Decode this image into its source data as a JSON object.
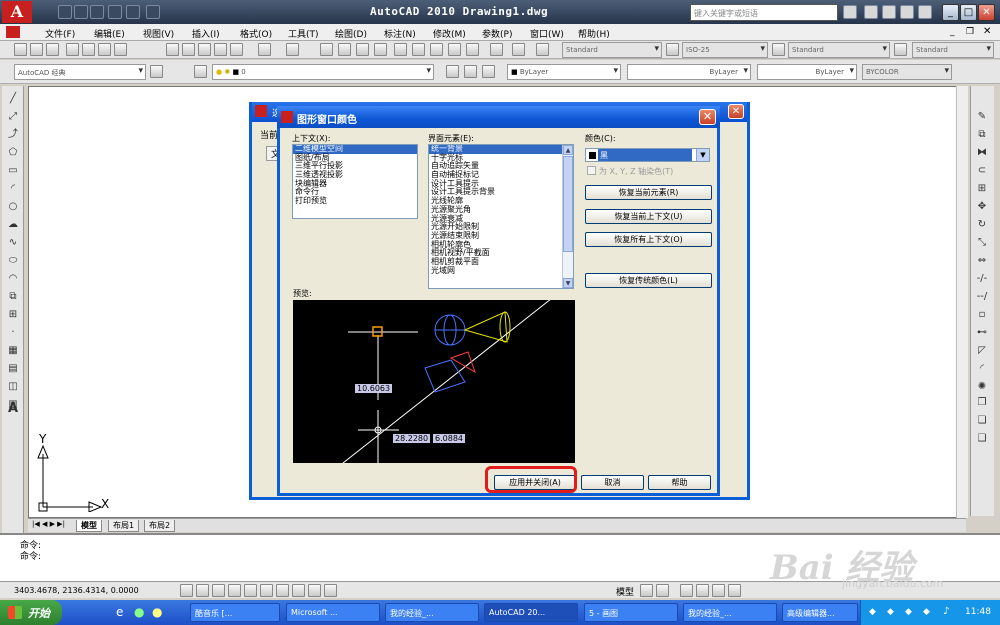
{
  "app": {
    "title": "AutoCAD 2010   Drawing1.dwg",
    "search_placeholder": "键入关键字或短语",
    "menu": [
      "文件(F)",
      "编辑(E)",
      "视图(V)",
      "插入(I)",
      "格式(O)",
      "工具(T)",
      "绘图(D)",
      "标注(N)",
      "修改(M)",
      "参数(P)",
      "窗口(W)",
      "帮助(H)"
    ],
    "toolbar": {
      "text_style": "Standard",
      "dim_style": "ISO-25",
      "table_style": "Standard",
      "mleader_style": "Standard",
      "workspace": "AutoCAD 经典",
      "layer": "0",
      "color": "ByLayer",
      "linetype": "ByLayer",
      "lineweight": "ByLayer",
      "plotstyle": "BYCOLOR"
    }
  },
  "layout_tabs": [
    "模型",
    "布局1",
    "布局2"
  ],
  "command": {
    "line1": "命令:",
    "line2": "命令:"
  },
  "status": {
    "coords": "3403.4678, 2136.4314, 0.0000",
    "model": "模型"
  },
  "ucs": {
    "x": "X",
    "y": "Y"
  },
  "back_dialog": {
    "title": "选",
    "current_label": "当前",
    "tab": "文"
  },
  "dialog": {
    "title": "图形窗口颜色",
    "context_label": "上下文(X):",
    "contexts": [
      "二维模型空间",
      "图纸/布局",
      "三维平行投影",
      "三维透视投影",
      "块编辑器",
      "命令行",
      "打印预览"
    ],
    "element_label": "界面元素(E):",
    "elements": [
      "统一背景",
      "十字光标",
      "自动追踪矢量",
      "自动捕捉标记",
      "设计工具提示",
      "设计工具提示背景",
      "光线轮廓",
      "光源聚光角",
      "光源衰减",
      "光源开始限制",
      "光源结束限制",
      "相机轮廓色",
      "相机视野/平截面",
      "相机剪裁平面",
      "光域网"
    ],
    "color_label": "颜色(C):",
    "color_value": "黑",
    "tint_label": "为 X, Y, Z 轴染色(T)",
    "btn_restore_element": "恢复当前元素(R)",
    "btn_restore_context": "恢复当前上下文(U)",
    "btn_restore_all": "恢复所有上下文(O)",
    "btn_restore_classic": "恢复传统颜色(L)",
    "preview_label": "预览:",
    "preview_dims": [
      "10.6063",
      "28.2280",
      "6.0884"
    ],
    "btn_apply": "应用并关闭(A)",
    "btn_cancel": "取消",
    "btn_help": "帮助"
  },
  "taskbar": {
    "start": "开始",
    "tasks": [
      "酷音乐 [...",
      "Microsoft ...",
      "我的经验_...",
      "AutoCAD 20...",
      "5 - 画图",
      "我的经验_...",
      "高级编辑器..."
    ],
    "clock": "11:48"
  },
  "watermark": {
    "main": "Bai 经验",
    "url": "jingyan.baidu.com"
  }
}
